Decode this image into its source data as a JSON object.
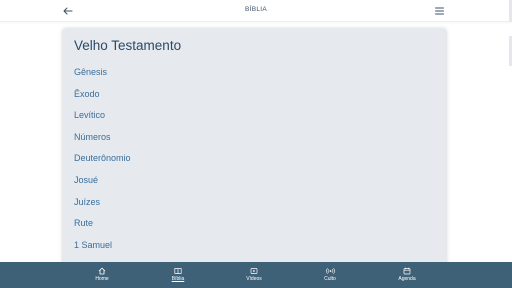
{
  "header": {
    "title": "BÍBLIA",
    "back_icon": "arrow-left-icon",
    "menu_icon": "menu-icon"
  },
  "colors": {
    "nav_background": "#3f6178",
    "card_background": "#e6e9ed",
    "title_text": "#2b4a67",
    "link_text": "#3a6e9e"
  },
  "card": {
    "title": "Velho Testamento",
    "books": [
      {
        "label": "Gênesis"
      },
      {
        "label": "Êxodo"
      },
      {
        "label": "Levítico"
      },
      {
        "label": "Números"
      },
      {
        "label": "Deuterônomio"
      },
      {
        "label": "Josué"
      },
      {
        "label": "Juízes"
      },
      {
        "label": "Rute"
      },
      {
        "label": "1 Samuel"
      }
    ]
  },
  "bottom_nav": {
    "active": "Bíblia",
    "items": [
      {
        "label": "Home",
        "icon": "home-icon"
      },
      {
        "label": "Bíblia",
        "icon": "book-icon"
      },
      {
        "label": "Vídeos",
        "icon": "video-icon"
      },
      {
        "label": "Culto",
        "icon": "broadcast-icon"
      },
      {
        "label": "Agenda",
        "icon": "calendar-icon"
      }
    ]
  }
}
